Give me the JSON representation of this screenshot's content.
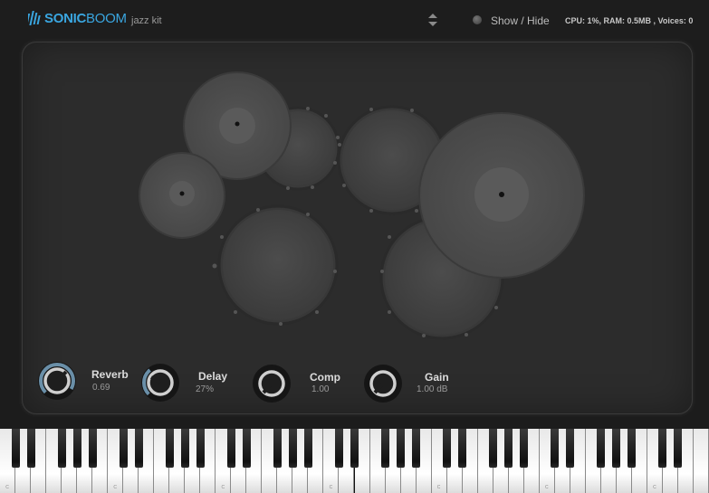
{
  "header": {
    "brand_sonic": "SONIC",
    "brand_boom": "BOOM",
    "preset_name": "jazz kit",
    "show_hide_label": "Show / Hide",
    "stats": "CPU: 1%, RAM: 0.5MB , Voices: 0"
  },
  "controls": [
    {
      "label": "Reverb",
      "value": "0.69",
      "level": 0.69
    },
    {
      "label": "Delay",
      "value": "27%",
      "level": 0.27
    },
    {
      "label": "Comp",
      "value": "1.00",
      "level": 0.0
    },
    {
      "label": "Gain",
      "value": "1.00 dB",
      "level": 0.0
    }
  ],
  "drum_kit": {
    "pieces": [
      "crash-cymbal",
      "tom",
      "splash-cymbal",
      "tom",
      "ride-cymbal",
      "floor-tom",
      "floor-tom"
    ]
  },
  "keyboard": {
    "octave_marker": "C",
    "white_key_count": 46
  },
  "colors": {
    "brand": "#3aa6e0",
    "knob_ring": "#cfcfcf",
    "knob_arc": "#6a8fa8"
  }
}
